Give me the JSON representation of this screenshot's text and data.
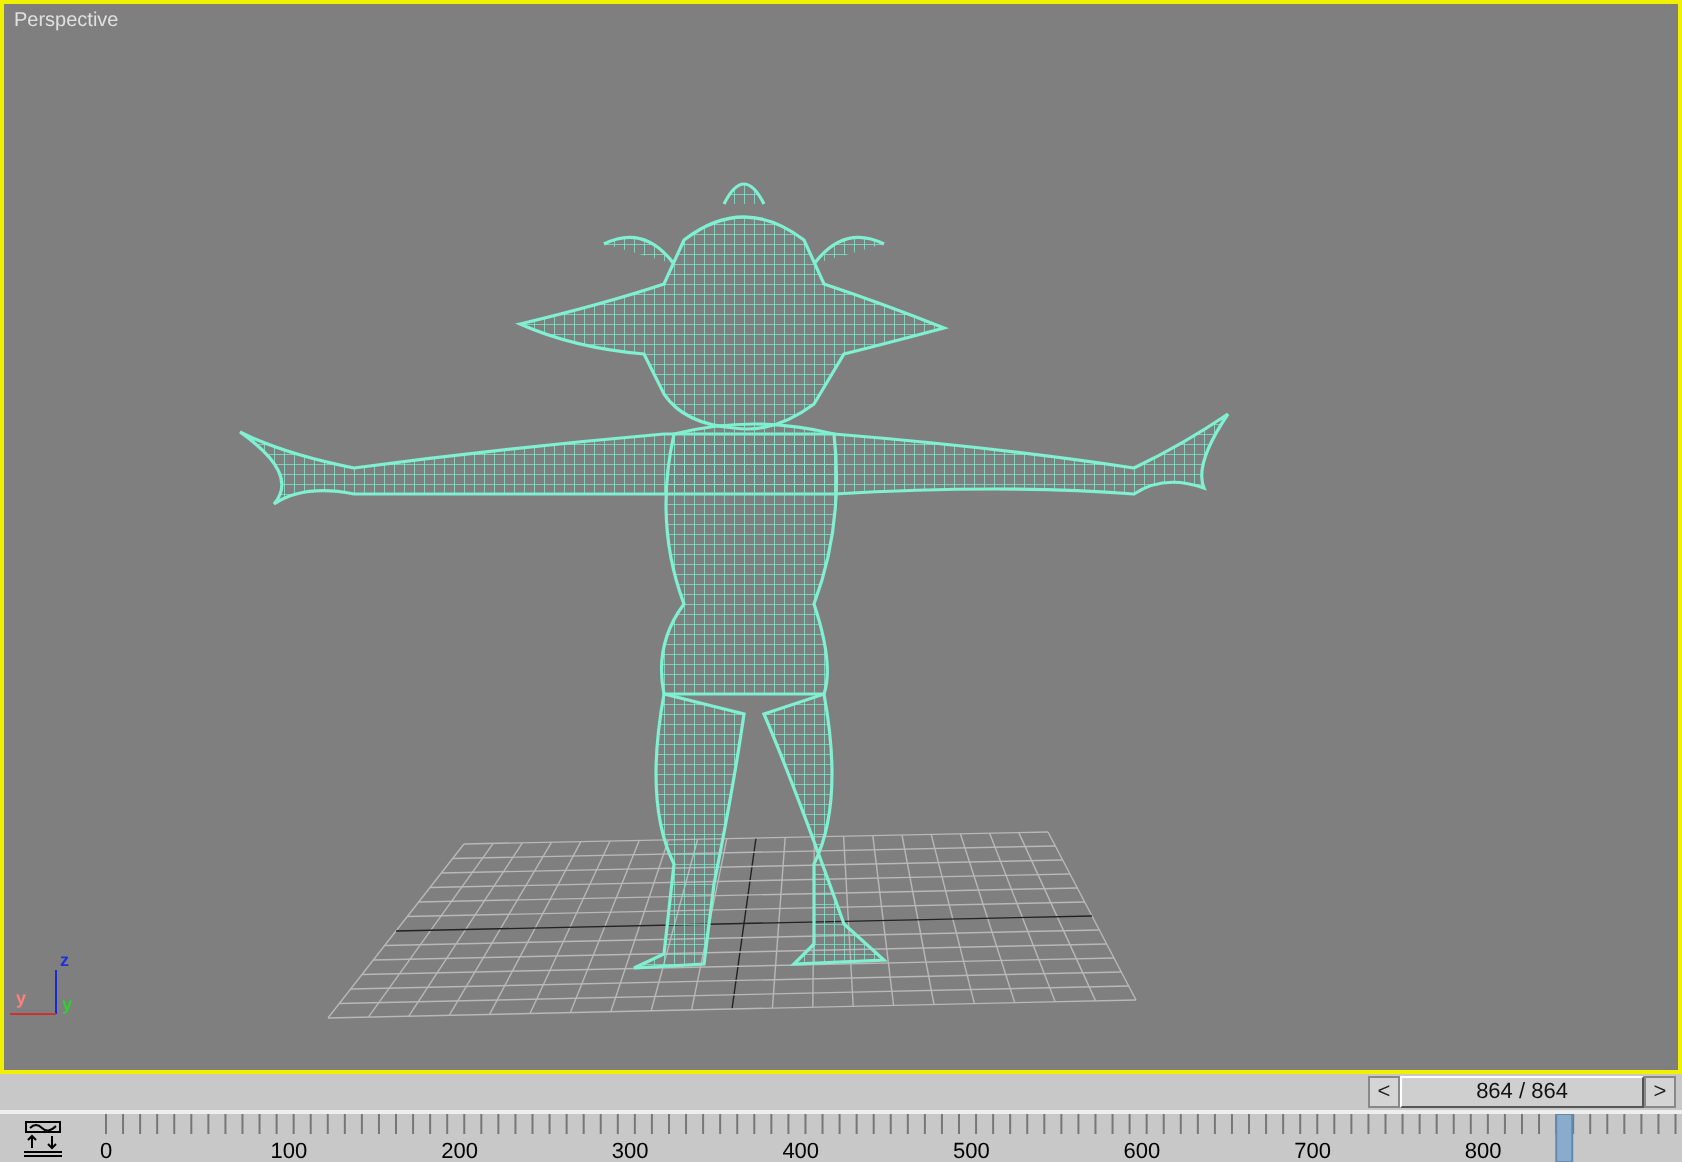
{
  "viewport": {
    "label": "Perspective",
    "axis_gizmo": {
      "labels": [
        {
          "text": "z",
          "color": "#2030e0"
        },
        {
          "text": "y",
          "color": "#ff8080"
        },
        {
          "text": "y",
          "color": "#30d030"
        }
      ]
    }
  },
  "time_slider": {
    "prev": "<",
    "value": "864 / 864",
    "next": ">"
  },
  "track_bar": {
    "labels": [
      "0",
      "100",
      "200",
      "300",
      "400",
      "500",
      "600",
      "700",
      "800"
    ],
    "level": 0.93
  }
}
